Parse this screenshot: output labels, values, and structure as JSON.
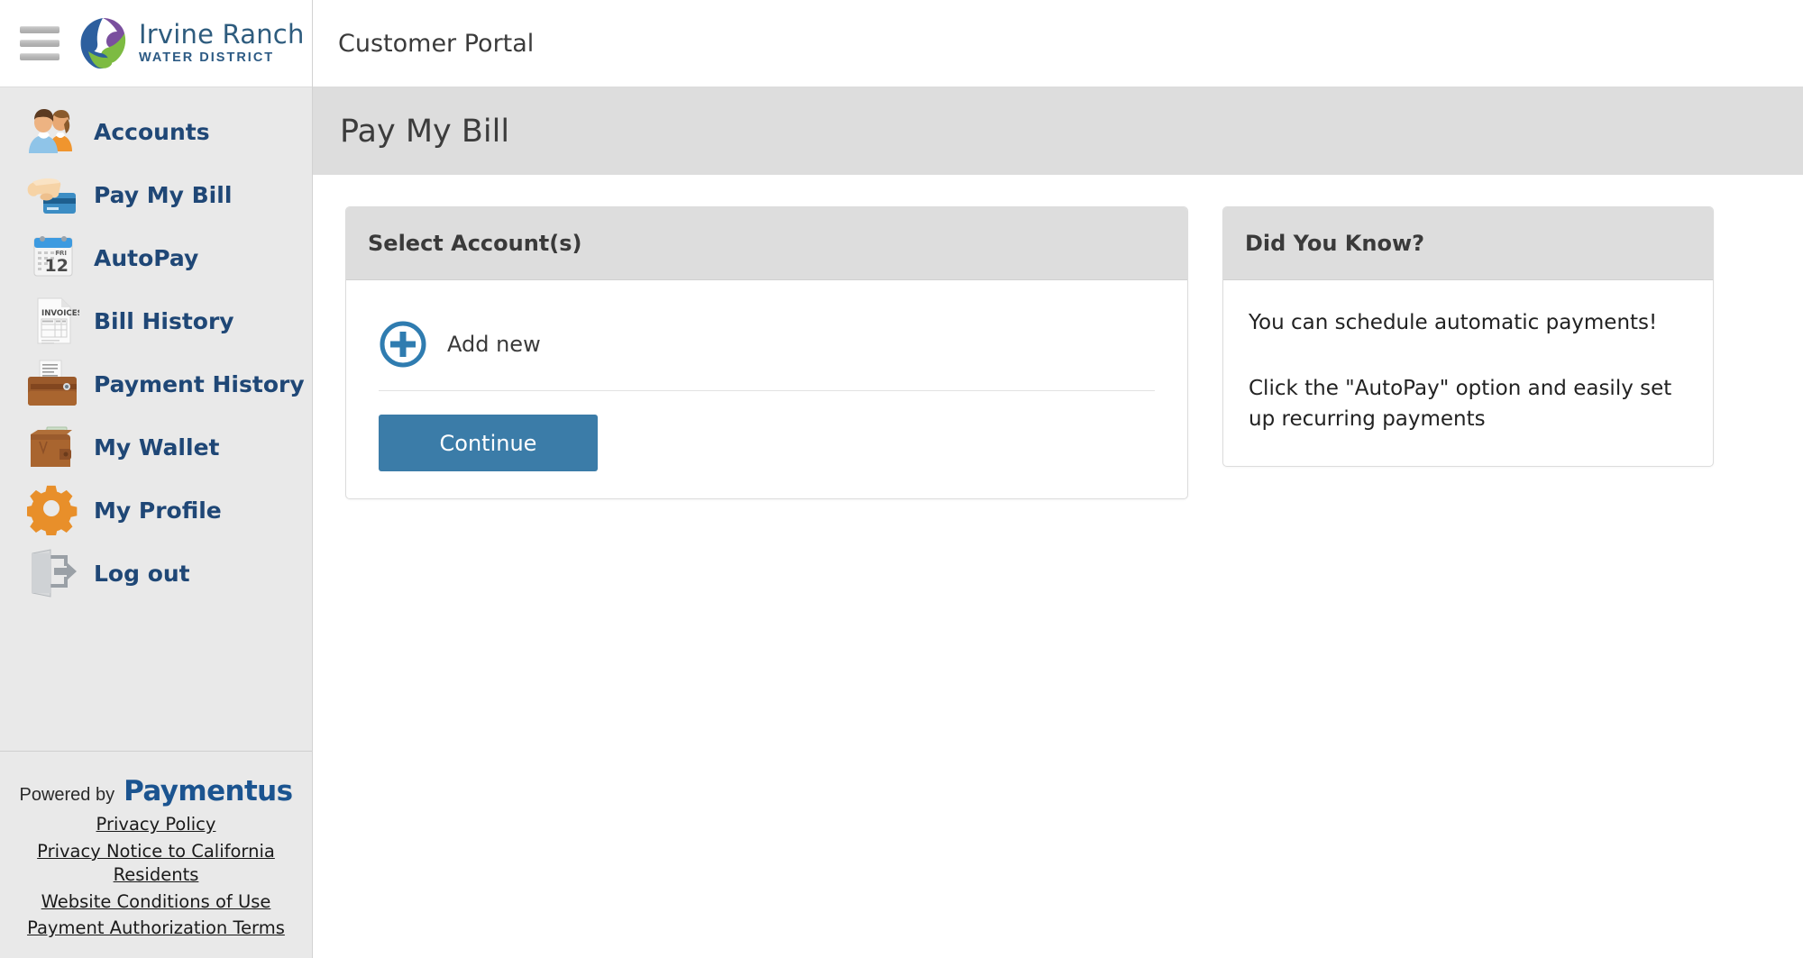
{
  "brand": {
    "logo_title": "Irvine Ranch",
    "logo_subtitle": "WATER DISTRICT",
    "menu_icon": "hamburger-menu-icon",
    "logo_icon": "irvine-ranch-water-district-logo"
  },
  "topbar": {
    "title": "Customer Portal"
  },
  "page": {
    "title": "Pay My Bill"
  },
  "sidebar": {
    "items": [
      {
        "label": "Accounts",
        "icon": "users-icon"
      },
      {
        "label": "Pay My Bill",
        "icon": "hand-credit-card-icon"
      },
      {
        "label": "AutoPay",
        "icon": "calendar-icon"
      },
      {
        "label": "Bill History",
        "icon": "invoice-document-icon"
      },
      {
        "label": "Payment History",
        "icon": "wallet-receipt-icon"
      },
      {
        "label": "My Wallet",
        "icon": "wallet-icon"
      },
      {
        "label": "My Profile",
        "icon": "gear-icon"
      },
      {
        "label": "Log out",
        "icon": "logout-door-icon"
      }
    ],
    "calendar_icon": {
      "weekday": "FRI",
      "day": "12"
    },
    "invoice_icon_label": "INVOICES",
    "footer": {
      "powered_by": "Powered by",
      "provider": "Paymentus",
      "links": [
        "Privacy Policy ",
        "Privacy Notice to California Residents ",
        "Website Conditions of Use ",
        "Payment Authorization Terms"
      ]
    }
  },
  "main": {
    "select_accounts_card": {
      "title": "Select Account(s)",
      "add_new_label": "Add new",
      "add_new_icon": "plus-circle-icon",
      "continue_label": "Continue"
    },
    "did_you_know_card": {
      "title": "Did You Know?",
      "paragraphs": [
        "You can schedule automatic payments!",
        "Click the \"AutoPay\" option and easily set up recurring payments"
      ]
    }
  },
  "colors": {
    "sidebar_bg": "#e9e9e9",
    "nav_text": "#1f4776",
    "primary_button": "#3b7ca8",
    "card_header_bg": "#dddddd",
    "page_header_bg": "#dddddd",
    "paymentus_blue": "#1b5490"
  }
}
